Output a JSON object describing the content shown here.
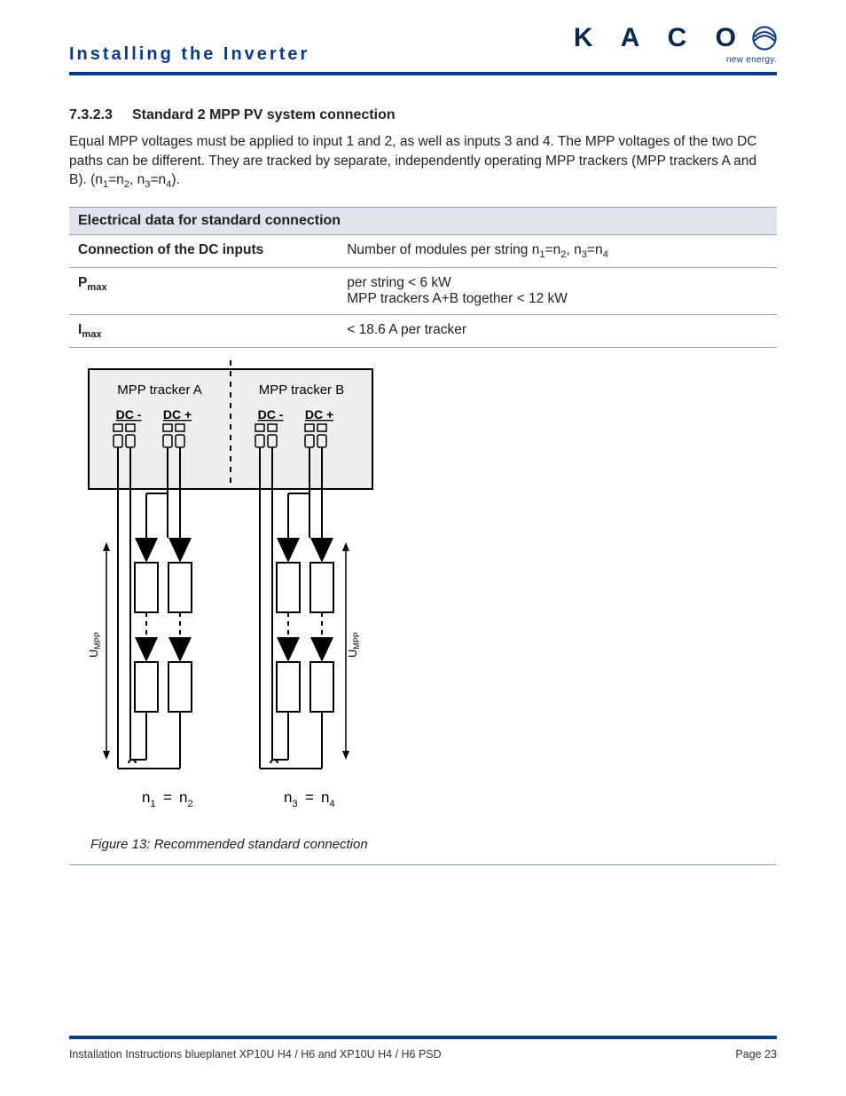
{
  "header": {
    "title": "Installing the Inverter",
    "brand": "K A C O",
    "brand_sub": "new energy."
  },
  "section": {
    "number": "7.3.2.3",
    "title": "Standard 2 MPP PV system connection",
    "paragraph_a": "Equal MPP voltages must be applied to input 1 and 2, as well as inputs 3 and 4. The MPP voltages of the two DC paths can be different. They are tracked by separate, independently operating MPP trackers (MPP trackers A and B). (n",
    "paragraph_b": "=n",
    "paragraph_c": ", n",
    "paragraph_d": "=n",
    "paragraph_e": ")."
  },
  "table": {
    "title": "Electrical data for standard connection",
    "r1": {
      "label": "Connection of the DC inputs",
      "val_a": "Number of modules per string n",
      "val_b": "=n",
      "val_c": ", n",
      "val_d": "=n"
    },
    "r2": {
      "label_sym": "P",
      "label_sub": "max",
      "val_line1": "per string < 6 kW",
      "val_line2": "MPP trackers A+B together < 12 kW"
    },
    "r3": {
      "label_sym": "I",
      "label_sub": "max",
      "val": "< 18.6 A per tracker"
    }
  },
  "diagram": {
    "tracker_a": "MPP tracker A",
    "tracker_b": "MPP tracker B",
    "dc_minus": "DC -",
    "dc_plus": "DC +",
    "umpp": "U",
    "umpp_sub": "MPP",
    "n1": "n",
    "n2": "n",
    "n3": "n",
    "n4": "n",
    "eq": "="
  },
  "figure_caption": "Figure 13:  Recommended standard connection",
  "footer": {
    "left": "Installation Instructions blueplanet XP10U H4 / H6 and XP10U H4 / H6 PSD",
    "right": "Page 23"
  }
}
